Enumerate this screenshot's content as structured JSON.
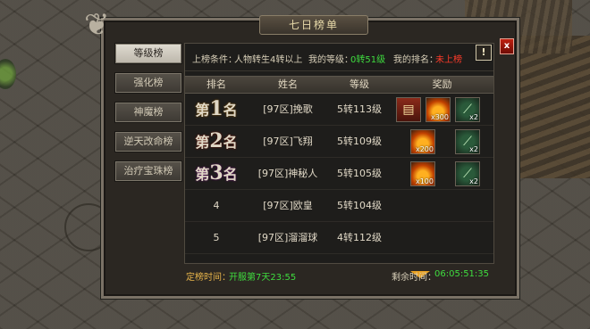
{
  "window": {
    "title": "七日榜单",
    "close_label": "x",
    "alert_label": "!"
  },
  "tabs": [
    {
      "label": "等级榜",
      "active": true
    },
    {
      "label": "强化榜",
      "active": false
    },
    {
      "label": "神魔榜",
      "active": false
    },
    {
      "label": "逆天改命榜",
      "active": false
    },
    {
      "label": "治疗宝珠榜",
      "active": false
    }
  ],
  "info": {
    "condition_label": "上榜条件：",
    "condition_value": "人物转生4转以上",
    "my_level_label": "我的等级：",
    "my_level_value": "0转51级",
    "my_rank_label": "我的排名：",
    "my_rank_value": "未上榜"
  },
  "table": {
    "headers": [
      "排名",
      "姓名",
      "等级",
      "奖励"
    ],
    "rows": [
      {
        "rank_prefix": "第",
        "rank_num": "1",
        "rank_suffix": "名",
        "name": "[97区]挽歌",
        "level": "5转113级",
        "rewards": [
          {
            "icon": "red-book-icon",
            "count": ""
          },
          {
            "icon": "fire-orb-icon",
            "count": "x300"
          },
          {
            "icon": "scroll-icon",
            "count": "x2"
          }
        ]
      },
      {
        "rank_prefix": "第",
        "rank_num": "2",
        "rank_suffix": "名",
        "name": "[97区]飞翔",
        "level": "5转109级",
        "rewards": [
          {
            "icon": "fire-orb-icon",
            "count": "x200"
          },
          {
            "icon": "scroll-icon",
            "count": "x2"
          }
        ]
      },
      {
        "rank_prefix": "第",
        "rank_num": "3",
        "rank_suffix": "名",
        "name": "[97区]神秘人",
        "level": "5转105级",
        "rewards": [
          {
            "icon": "fire-orb-icon",
            "count": "x100"
          },
          {
            "icon": "scroll-icon",
            "count": "x2"
          }
        ]
      },
      {
        "rank": "4",
        "name": "[97区]欧皇",
        "level": "5转104级",
        "rewards": []
      },
      {
        "rank": "5",
        "name": "[97区]溜溜球",
        "level": "4转112级",
        "rewards": []
      }
    ]
  },
  "footer": {
    "settle_label": "定榜时间：",
    "settle_value": "开服第7天23:55",
    "remain_label": "剩余时间：",
    "remain_value": "06:05:51:35"
  },
  "colors": {
    "highlight_green": "#3fdc3f",
    "warn_red": "#ff3b2a",
    "rank1": "#f0b030",
    "rank2": "#ff5a3a",
    "rank3": "#f060e0"
  }
}
